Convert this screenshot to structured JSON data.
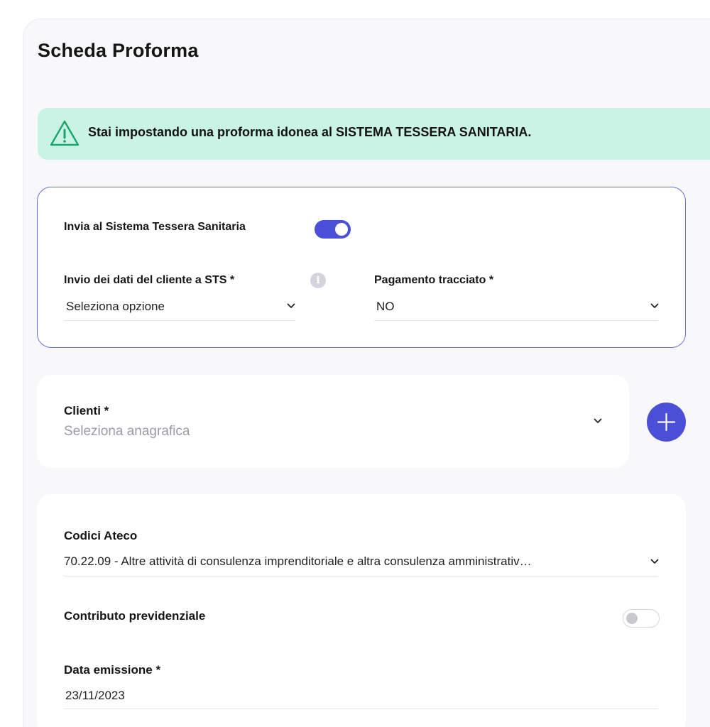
{
  "page": {
    "title": "Scheda Proforma"
  },
  "alert": {
    "text": "Stai impostando una proforma idonea al SISTEMA TESSERA SANITARIA.",
    "icon": "warning-icon",
    "color": "#c9f3e4"
  },
  "sts": {
    "toggle_label": "Invia al Sistema Tessera Sanitaria",
    "toggle_on": true,
    "invio_label": "Invio dei dati del cliente a STS *",
    "invio_value": "Seleziona opzione",
    "pagamento_label": "Pagamento tracciato *",
    "pagamento_value": "NO"
  },
  "clienti": {
    "label": "Clienti *",
    "placeholder": "Seleziona anagrafica"
  },
  "main": {
    "ateco_label": "Codici Ateco",
    "ateco_value": "70.22.09 - Altre attività di consulenza imprenditoriale e altra consulenza amministrativ…",
    "contributo_label": "Contributo previdenziale",
    "contributo_on": false,
    "data_label": "Data emissione *",
    "data_value": "23/11/2023"
  },
  "colors": {
    "accent": "#4b4ed6",
    "alert_bg": "#c9f3e4",
    "card_border": "#6a6fd6"
  }
}
